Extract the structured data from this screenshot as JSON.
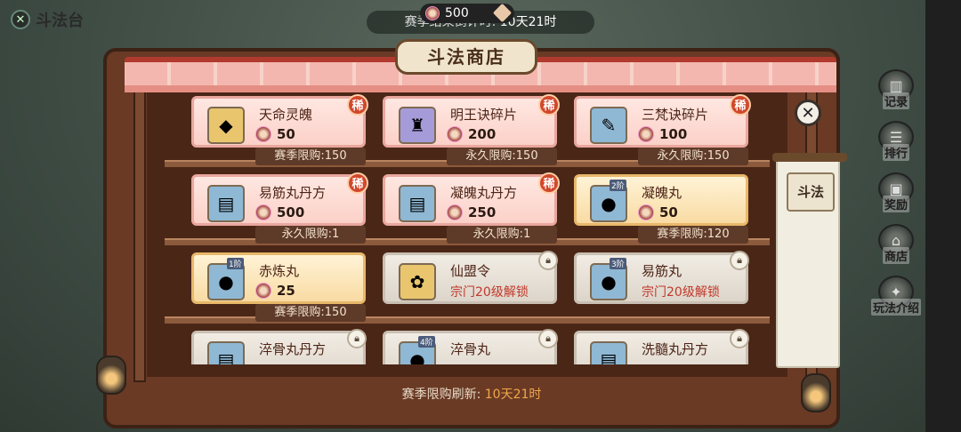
{
  "header": {
    "back_label": "斗法台",
    "currency_value": "500",
    "countdown_label": "赛季结束倒计时:",
    "countdown_value": "10天21时"
  },
  "shop": {
    "title": "斗法商店",
    "refresh_label": "赛季限购刷新:",
    "refresh_value": "10天21时"
  },
  "items": [
    {
      "name": "天命灵魄",
      "price": "50",
      "limit": "赛季限购:150",
      "rare": "稀",
      "style": "pink",
      "icon": "crystal-shard",
      "icon_color": "gold"
    },
    {
      "name": "明王诀碎片",
      "price": "200",
      "limit": "永久限购:150",
      "rare": "稀",
      "style": "pink",
      "icon": "statue-fragment",
      "icon_color": "purple"
    },
    {
      "name": "三梵诀碎片",
      "price": "100",
      "limit": "永久限购:150",
      "rare": "稀",
      "style": "pink",
      "icon": "scroll-fragment",
      "icon_color": "blue"
    },
    {
      "name": "易筋丸丹方",
      "price": "500",
      "limit": "永久限购:1",
      "rare": "稀",
      "style": "pink",
      "icon": "recipe-scroll",
      "icon_color": "blue"
    },
    {
      "name": "凝魄丸丹方",
      "price": "250",
      "limit": "永久限购:1",
      "rare": "稀",
      "style": "pink",
      "icon": "recipe-scroll",
      "icon_color": "blue"
    },
    {
      "name": "凝魄丸",
      "price": "50",
      "limit": "赛季限购:120",
      "grade": "2阶",
      "style": "gold",
      "icon": "green-pill",
      "icon_color": "blue"
    },
    {
      "name": "赤炼丸",
      "price": "25",
      "limit": "赛季限购:150",
      "grade": "1阶",
      "style": "gold",
      "icon": "red-pill",
      "icon_color": "blue"
    },
    {
      "name": "仙盟令",
      "lock_text": "宗门20级解锁",
      "style": "gray",
      "icon": "alliance-token",
      "icon_color": "gold"
    },
    {
      "name": "易筋丸",
      "lock_text": "宗门20级解锁",
      "grade": "3阶",
      "style": "gray",
      "icon": "blue-pill",
      "icon_color": "blue"
    },
    {
      "name": "淬骨丸丹方",
      "style": "gray",
      "icon": "recipe-scroll",
      "icon_color": "blue"
    },
    {
      "name": "淬骨丸",
      "grade": "4阶",
      "style": "gray",
      "icon": "blue-pill",
      "icon_color": "blue"
    },
    {
      "name": "洗髓丸丹方",
      "style": "gray",
      "icon": "recipe-scroll",
      "icon_color": "blue"
    }
  ],
  "side_tab": {
    "label": "斗法"
  },
  "right_menu": [
    {
      "label": "记录",
      "icon": "record-icon"
    },
    {
      "label": "排行",
      "icon": "ranking-icon"
    },
    {
      "label": "奖励",
      "icon": "reward-icon"
    },
    {
      "label": "商店",
      "icon": "shop-icon"
    },
    {
      "label": "玩法介绍",
      "icon": "guide-icon"
    }
  ],
  "colors": {
    "rare_badge": "#d0482c",
    "lock_text": "#c0392b",
    "refresh_time": "#f1a74a"
  }
}
